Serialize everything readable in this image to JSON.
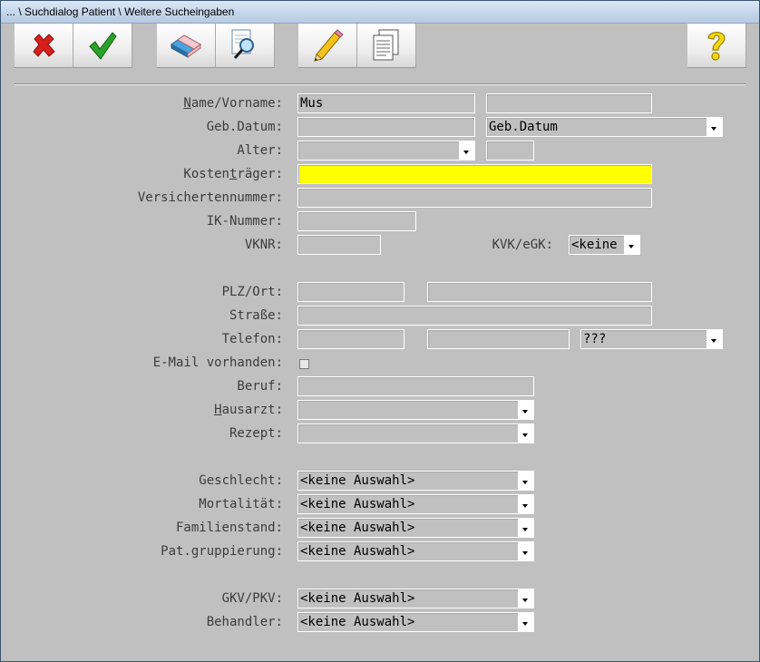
{
  "window": {
    "title": "... \\ Suchdialog Patient \\ Weitere Sucheingaben"
  },
  "toolbar": {
    "buttons": [
      {
        "name": "cancel",
        "icon": "red-x-icon"
      },
      {
        "name": "ok",
        "icon": "green-check-icon"
      },
      {
        "name": "eraser",
        "icon": "eraser-icon"
      },
      {
        "name": "search-document",
        "icon": "magnifier-document-icon"
      },
      {
        "name": "edit",
        "icon": "pencil-icon"
      },
      {
        "name": "copy",
        "icon": "documents-icon"
      },
      {
        "name": "help",
        "icon": "yellow-question-icon"
      }
    ]
  },
  "colors": {
    "highlight_field": "#ffff00",
    "window_bg": "#c0c0c0"
  },
  "form": {
    "name_label_u": "N",
    "name_label_rest": "ame/Vorname:",
    "name_value": "Mus",
    "vorname_value": "",
    "gebdatum_label": "Geb.Datum:",
    "gebdatum_value": "",
    "gebdatum_mode": "Geb.Datum",
    "alter_label": "Alter:",
    "alter_value": "",
    "alter_value2": "",
    "kostentraeger_label_pre": "Kosten",
    "kostentraeger_label_u": "t",
    "kostentraeger_label_post": "räger:",
    "kostentraeger_value": "",
    "versicherten_label": "Versichertennummer:",
    "versicherten_value": "",
    "ik_label": "IK-Nummer:",
    "ik_value": "",
    "vknr_label": "VKNR:",
    "vknr_value": "",
    "kvk_label": "KVK/eGK:",
    "kvk_value": "<keine",
    "plz_label": "PLZ/Ort:",
    "plz_value": "",
    "ort_value": "",
    "strasse_label": "Straße:",
    "strasse_value": "",
    "telefon_label": "Telefon:",
    "telefon_value1": "",
    "telefon_value2": "",
    "telefon_type": "???",
    "email_label": "E-Mail vorhanden:",
    "beruf_label": "Beruf:",
    "beruf_value": "",
    "hausarzt_label_u": "H",
    "hausarzt_label_rest": "ausarzt:",
    "hausarzt_value": "",
    "rezept_label": "Rezept:",
    "rezept_value": "",
    "geschlecht_label": "Geschlecht:",
    "geschlecht_value": "<keine Auswahl>",
    "mortalitaet_label": "Mortalität:",
    "mortalitaet_value": "<keine Auswahl>",
    "familienstand_label": "Familienstand:",
    "familienstand_value": "<keine Auswahl>",
    "patgruppe_label": "Pat.gruppierung:",
    "patgruppe_value": "<keine Auswahl>",
    "gkv_label": "GKV/PKV:",
    "gkv_value": "<keine Auswahl>",
    "behandler_label": "Behandler:",
    "behandler_value": "<keine Auswahl>"
  }
}
